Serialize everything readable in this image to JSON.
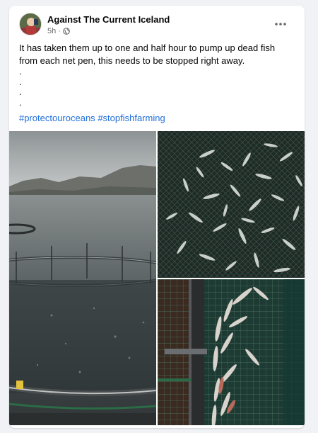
{
  "post": {
    "author": "Against The Current Iceland",
    "time": "5h",
    "separator": "·",
    "privacy_icon": "globe-icon",
    "more_icon": "more-horizontal-icon",
    "text_lines": [
      "It has taken them up to one and half hour to pump up dead fish",
      "from each net pen, this needs to be stopped right away."
    ],
    "dots": [
      ".",
      ".",
      ".",
      "."
    ],
    "hashtags": [
      "#protectouroceans",
      "#stopfishfarming"
    ]
  },
  "colors": {
    "link": "#216fdb",
    "meta": "#65676b",
    "background": "#f0f2f5"
  },
  "photos": [
    {
      "name": "fish-farm-fjord-photo"
    },
    {
      "name": "dead-fish-in-net-photo"
    },
    {
      "name": "fish-pump-pipe-photo"
    }
  ]
}
